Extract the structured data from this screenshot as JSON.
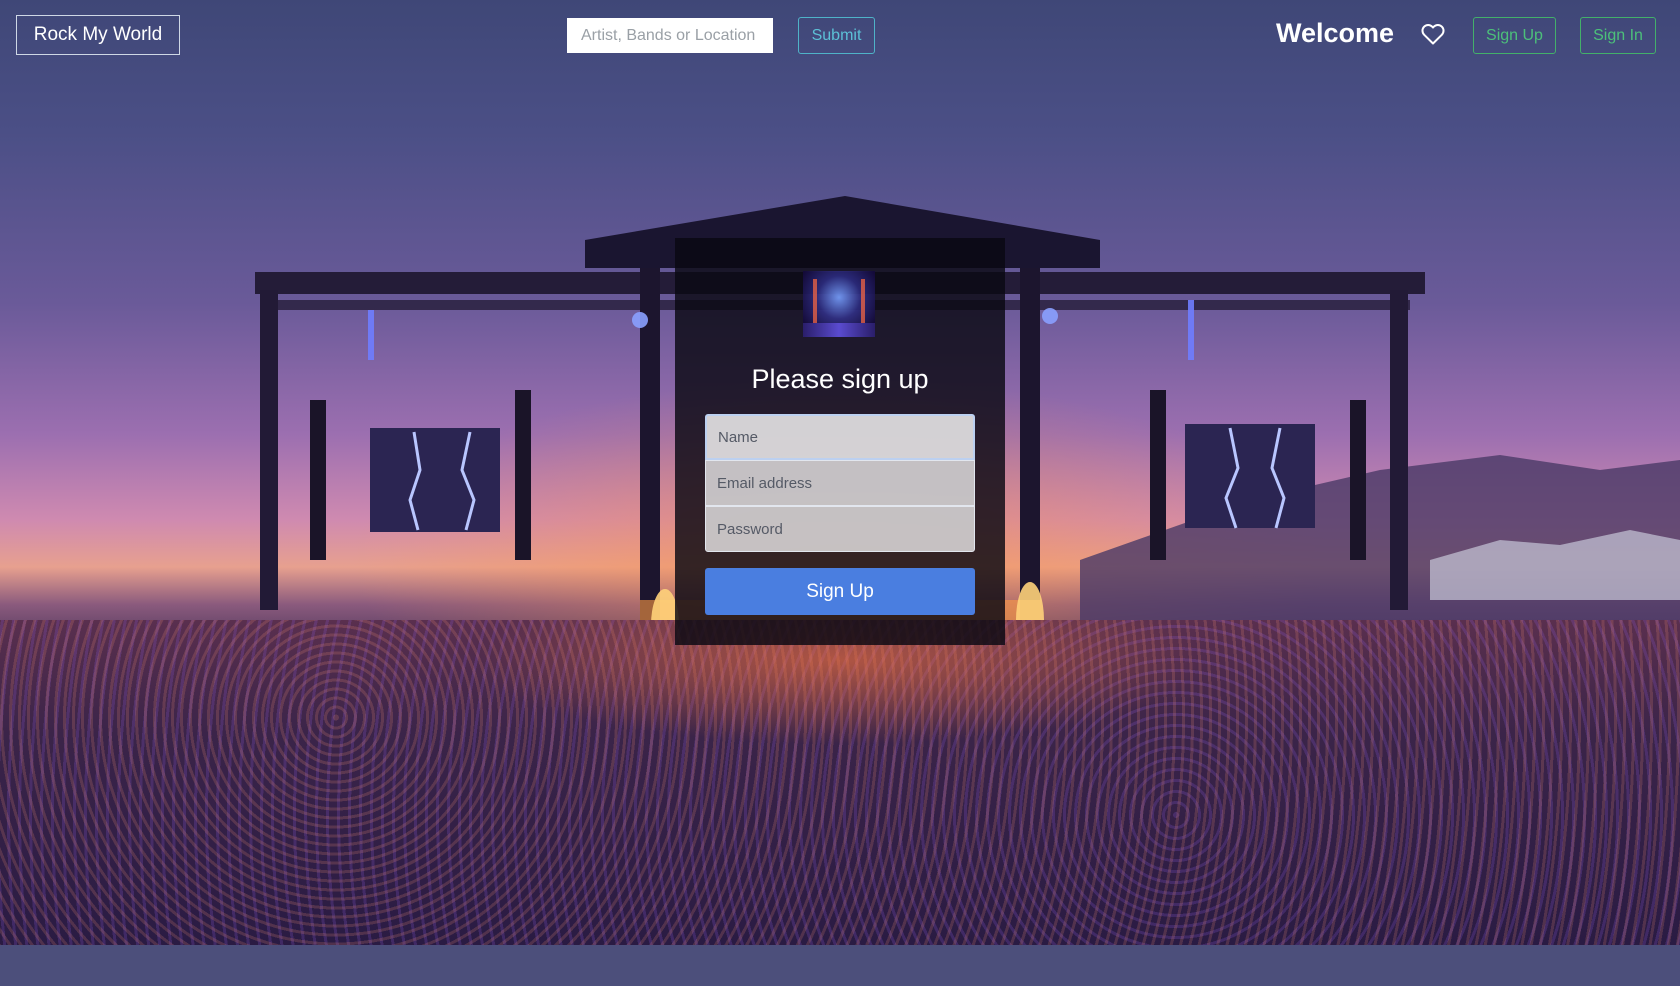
{
  "navbar": {
    "brand": "Rock My World",
    "search_placeholder": "Artist, Bands or Location",
    "submit_label": "Submit",
    "welcome_text": "Welcome",
    "favorites_icon": "heart-icon",
    "sign_up_label": "Sign Up",
    "sign_in_label": "Sign In"
  },
  "signup_form": {
    "title": "Please sign up",
    "name_placeholder": "Name",
    "email_placeholder": "Email address",
    "password_placeholder": "Password",
    "submit_label": "Sign Up"
  },
  "colors": {
    "nav_outline_light": "#cfd8e6",
    "submit_accent": "#4fb3c8",
    "auth_accent": "#43b06a",
    "primary_button": "#4a7ee0"
  }
}
